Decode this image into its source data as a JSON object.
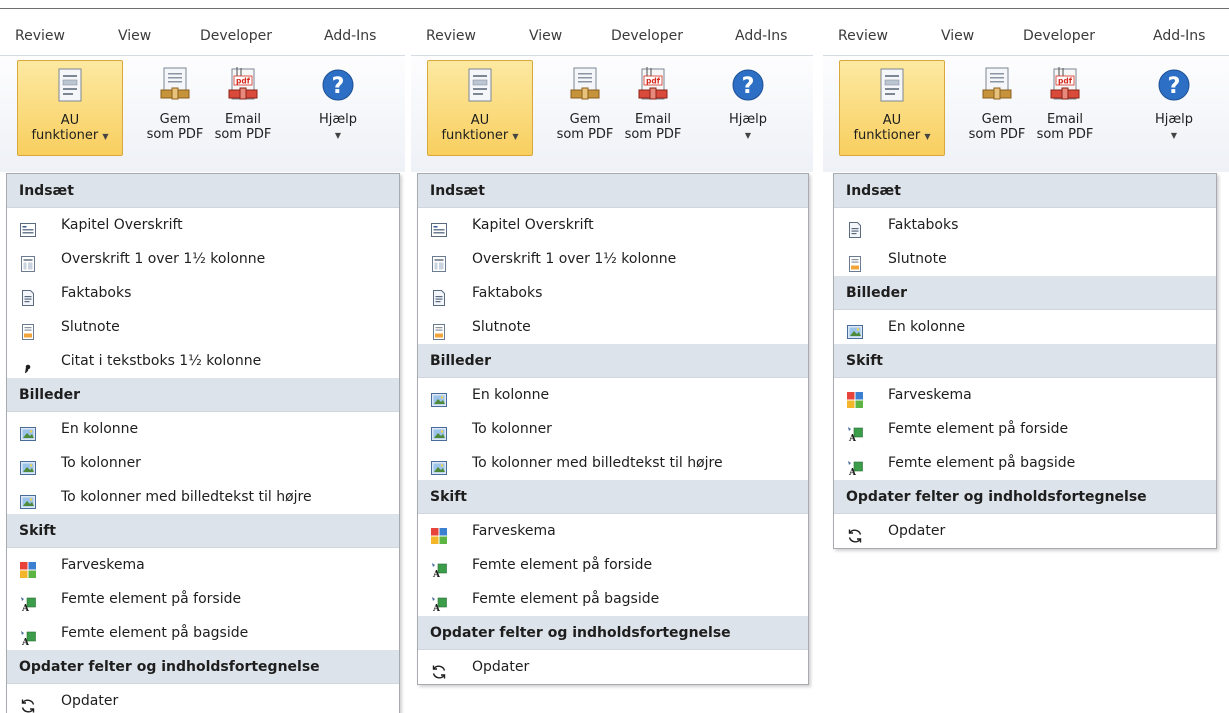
{
  "tabs": [
    "Review",
    "View",
    "Developer",
    "Add-Ins"
  ],
  "ribbon": {
    "au": {
      "line1": "AU",
      "line2": "funktioner"
    },
    "gem": {
      "line1": "Gem",
      "line2": "som PDF"
    },
    "email": {
      "line1": "Email",
      "line2": "som PDF"
    },
    "help": {
      "label": "Hjælp"
    },
    "pdf_badge": "pdf",
    "help_glyph": "?"
  },
  "menus": [
    {
      "sections": [
        {
          "header": "Indsæt",
          "items": [
            {
              "label": "Kapitel Overskrift",
              "icon": "chapter-heading-icon"
            },
            {
              "label": "Overskrift 1 over 1½ kolonne",
              "icon": "column-layout-icon"
            },
            {
              "label": "Faktaboks",
              "icon": "factbox-icon"
            },
            {
              "label": "Slutnote",
              "icon": "endnote-icon"
            },
            {
              "label": "Citat i tekstboks 1½ kolonne",
              "icon": "quote-icon"
            }
          ]
        },
        {
          "header": "Billeder",
          "items": [
            {
              "label": "En kolonne",
              "icon": "picture-icon"
            },
            {
              "label": "To kolonner",
              "icon": "picture-icon"
            },
            {
              "label": "To kolonner med billedtekst til højre",
              "icon": "picture-icon"
            }
          ]
        },
        {
          "header": "Skift",
          "items": [
            {
              "label": "Farveskema",
              "icon": "color-scheme-icon"
            },
            {
              "label": "Femte element på forside",
              "icon": "element-icon"
            },
            {
              "label": "Femte element på bagside",
              "icon": "element-icon"
            }
          ]
        },
        {
          "header": "Opdater felter og indholdsfortegnelse",
          "items": [
            {
              "label": "Opdater",
              "icon": "refresh-icon"
            }
          ]
        }
      ]
    },
    {
      "sections": [
        {
          "header": "Indsæt",
          "items": [
            {
              "label": "Kapitel Overskrift",
              "icon": "chapter-heading-icon"
            },
            {
              "label": "Overskrift 1 over 1½ kolonne",
              "icon": "column-layout-icon"
            },
            {
              "label": "Faktaboks",
              "icon": "factbox-icon"
            },
            {
              "label": "Slutnote",
              "icon": "endnote-icon"
            }
          ]
        },
        {
          "header": "Billeder",
          "items": [
            {
              "label": "En kolonne",
              "icon": "picture-icon"
            },
            {
              "label": "To kolonner",
              "icon": "picture-icon"
            },
            {
              "label": "To kolonner med billedtekst til højre",
              "icon": "picture-icon"
            }
          ]
        },
        {
          "header": "Skift",
          "items": [
            {
              "label": "Farveskema",
              "icon": "color-scheme-icon"
            },
            {
              "label": "Femte element på forside",
              "icon": "element-icon"
            },
            {
              "label": "Femte element på bagside",
              "icon": "element-icon"
            }
          ]
        },
        {
          "header": "Opdater felter og indholdsfortegnelse",
          "items": [
            {
              "label": "Opdater",
              "icon": "refresh-icon"
            }
          ]
        }
      ]
    },
    {
      "sections": [
        {
          "header": "Indsæt",
          "items": [
            {
              "label": "Faktaboks",
              "icon": "factbox-icon"
            },
            {
              "label": "Slutnote",
              "icon": "endnote-icon"
            }
          ]
        },
        {
          "header": "Billeder",
          "items": [
            {
              "label": "En kolonne",
              "icon": "picture-icon"
            }
          ]
        },
        {
          "header": "Skift",
          "items": [
            {
              "label": "Farveskema",
              "icon": "color-scheme-icon"
            },
            {
              "label": "Femte element på forside",
              "icon": "element-icon"
            },
            {
              "label": "Femte element på bagside",
              "icon": "element-icon"
            }
          ]
        },
        {
          "header": "Opdater felter og indholdsfortegnelse",
          "items": [
            {
              "label": "Opdater",
              "icon": "refresh-icon"
            }
          ]
        }
      ]
    }
  ],
  "colors": {
    "active_button": "#f8cf5f",
    "section_header_bg": "#dde3ea",
    "help_blue": "#2d6fc4",
    "pdf_red": "#d42b1e"
  }
}
